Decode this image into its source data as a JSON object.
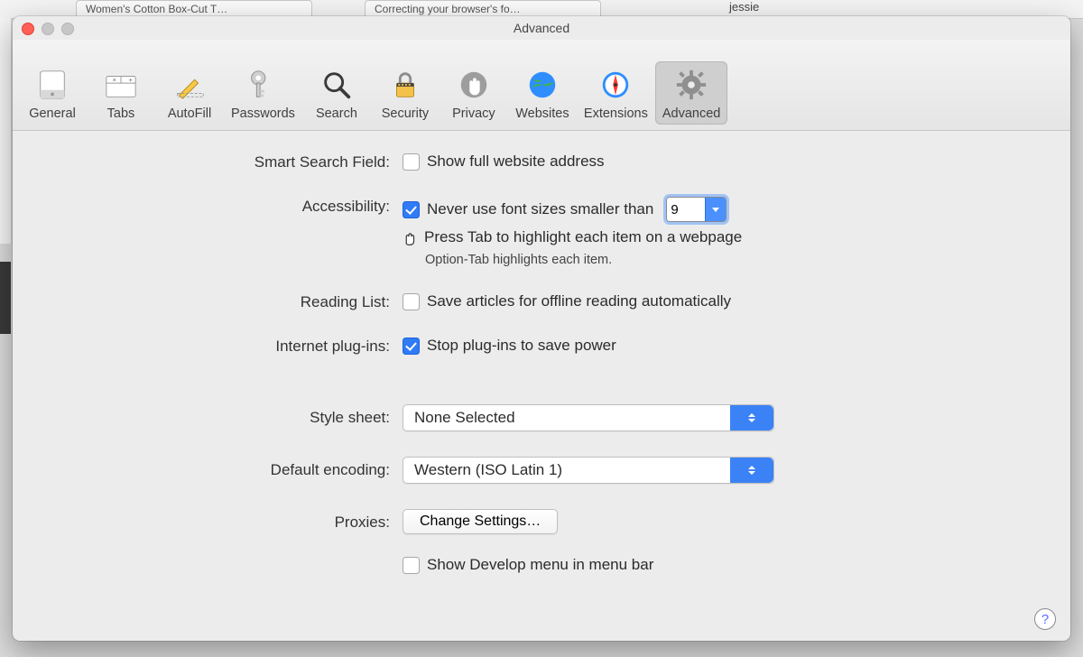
{
  "background": {
    "tab1": "Women's Cotton Box-Cut T…",
    "tab2": "Correcting your browser's fo…",
    "user": "jessie"
  },
  "window": {
    "title": "Advanced",
    "toolbar": [
      {
        "id": "general",
        "label": "General"
      },
      {
        "id": "tabs",
        "label": "Tabs"
      },
      {
        "id": "autofill",
        "label": "AutoFill"
      },
      {
        "id": "passwords",
        "label": "Passwords"
      },
      {
        "id": "search",
        "label": "Search"
      },
      {
        "id": "security",
        "label": "Security"
      },
      {
        "id": "privacy",
        "label": "Privacy"
      },
      {
        "id": "websites",
        "label": "Websites"
      },
      {
        "id": "extensions",
        "label": "Extensions"
      },
      {
        "id": "advanced",
        "label": "Advanced"
      }
    ],
    "selected_tab": "advanced"
  },
  "form": {
    "smart_search": {
      "label": "Smart Search Field:",
      "checkbox": "Show full website address",
      "checked": false
    },
    "accessibility": {
      "label": "Accessibility:",
      "min_font": {
        "text": "Never use font sizes smaller than",
        "checked": true,
        "value": "9"
      },
      "tab_highlight": {
        "text": "Press Tab to highlight each item on a webpage",
        "checked": false
      },
      "note": "Option-Tab highlights each item."
    },
    "reading_list": {
      "label": "Reading List:",
      "checkbox": "Save articles for offline reading automatically",
      "checked": false
    },
    "plugins": {
      "label": "Internet plug-ins:",
      "checkbox": "Stop plug-ins to save power",
      "checked": true
    },
    "style_sheet": {
      "label": "Style sheet:",
      "value": "None Selected"
    },
    "encoding": {
      "label": "Default encoding:",
      "value": "Western (ISO Latin 1)"
    },
    "proxies": {
      "label": "Proxies:",
      "button": "Change Settings…"
    },
    "develop": {
      "checkbox": "Show Develop menu in menu bar",
      "checked": false
    }
  },
  "help": "?"
}
